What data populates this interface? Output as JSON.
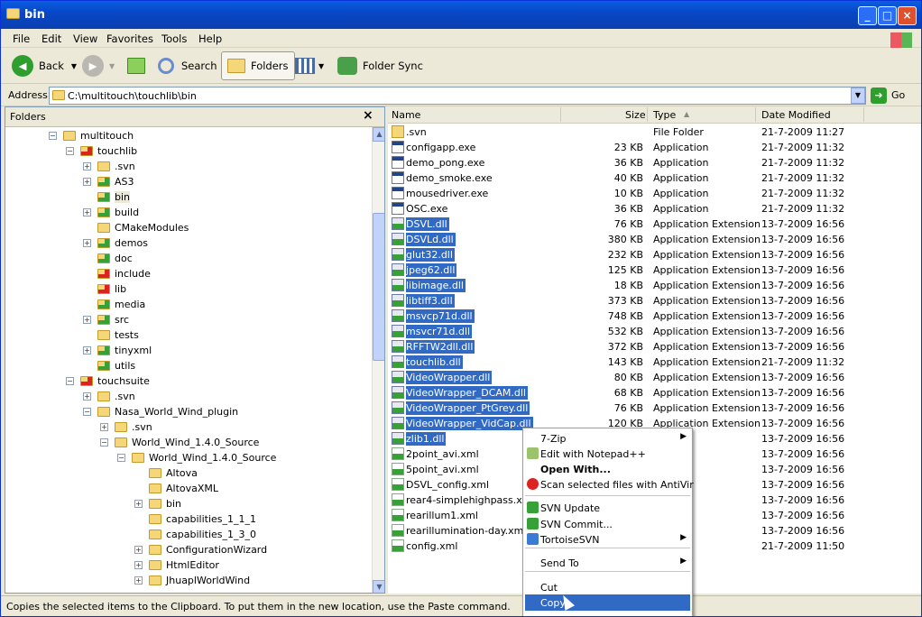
{
  "window": {
    "title": "bin"
  },
  "menu": [
    "File",
    "Edit",
    "View",
    "Favorites",
    "Tools",
    "Help"
  ],
  "toolbar": {
    "back": "Back",
    "search": "Search",
    "folders": "Folders",
    "folder_sync": "Folder Sync"
  },
  "address": {
    "label": "Address",
    "value": "C:\\multitouch\\touchlib\\bin",
    "go": "Go"
  },
  "folders_pane": {
    "title": "Folders",
    "close": "×",
    "items": [
      {
        "label": "multitouch",
        "expander": "−",
        "style": ""
      },
      {
        "label": "touchlib",
        "expander": "−",
        "style": "red"
      },
      {
        "label": ".svn",
        "expander": "+",
        "style": ""
      },
      {
        "label": "AS3",
        "expander": "+",
        "style": "svn"
      },
      {
        "label": "bin",
        "expander": "",
        "style": "svn"
      },
      {
        "label": "build",
        "expander": "+",
        "style": "svn"
      },
      {
        "label": "CMakeModules",
        "expander": "",
        "style": ""
      },
      {
        "label": "demos",
        "expander": "+",
        "style": "svn"
      },
      {
        "label": "doc",
        "expander": "",
        "style": "svn"
      },
      {
        "label": "include",
        "expander": "",
        "style": "red"
      },
      {
        "label": "lib",
        "expander": "",
        "style": "red"
      },
      {
        "label": "media",
        "expander": "",
        "style": "svn"
      },
      {
        "label": "src",
        "expander": "+",
        "style": "svn"
      },
      {
        "label": "tests",
        "expander": "",
        "style": ""
      },
      {
        "label": "tinyxml",
        "expander": "+",
        "style": "svn"
      },
      {
        "label": "utils",
        "expander": "",
        "style": "svn"
      },
      {
        "label": "touchsuite",
        "expander": "−",
        "style": "red"
      },
      {
        "label": ".svn",
        "expander": "+",
        "style": ""
      },
      {
        "label": "Nasa_World_Wind_plugin",
        "expander": "−",
        "style": ""
      },
      {
        "label": ".svn",
        "expander": "+",
        "style": ""
      },
      {
        "label": "World_Wind_1.4.0_Source",
        "expander": "−",
        "style": ""
      },
      {
        "label": "World_Wind_1.4.0_Source",
        "expander": "−",
        "style": ""
      },
      {
        "label": "Altova",
        "expander": "",
        "style": ""
      },
      {
        "label": "AltovaXML",
        "expander": "",
        "style": ""
      },
      {
        "label": "bin",
        "expander": "+",
        "style": ""
      },
      {
        "label": "capabilities_1_1_1",
        "expander": "",
        "style": ""
      },
      {
        "label": "capabilities_1_3_0",
        "expander": "",
        "style": ""
      },
      {
        "label": "ConfigurationWizard",
        "expander": "+",
        "style": ""
      },
      {
        "label": "HtmlEditor",
        "expander": "+",
        "style": ""
      },
      {
        "label": "JhuaplWorldWind",
        "expander": "+",
        "style": ""
      }
    ]
  },
  "columns": {
    "name": "Name",
    "size": "Size",
    "type": "Type",
    "date": "Date Modified"
  },
  "files": [
    {
      "name": ".svn",
      "size": "",
      "type": "File Folder",
      "date": "21-7-2009 11:27",
      "icon": "fld",
      "selected": false
    },
    {
      "name": "configapp.exe",
      "size": "23 KB",
      "type": "Application",
      "date": "21-7-2009 11:32",
      "icon": "exe",
      "selected": false
    },
    {
      "name": "demo_pong.exe",
      "size": "36 KB",
      "type": "Application",
      "date": "21-7-2009 11:32",
      "icon": "exe",
      "selected": false
    },
    {
      "name": "demo_smoke.exe",
      "size": "40 KB",
      "type": "Application",
      "date": "21-7-2009 11:32",
      "icon": "exe",
      "selected": false
    },
    {
      "name": "mousedriver.exe",
      "size": "10 KB",
      "type": "Application",
      "date": "21-7-2009 11:32",
      "icon": "exe",
      "selected": false
    },
    {
      "name": "OSC.exe",
      "size": "36 KB",
      "type": "Application",
      "date": "21-7-2009 11:32",
      "icon": "exe",
      "selected": false
    },
    {
      "name": "DSVL.dll",
      "size": "76 KB",
      "type": "Application Extension",
      "date": "13-7-2009 16:56",
      "icon": "dll",
      "selected": true
    },
    {
      "name": "DSVLd.dll",
      "size": "380 KB",
      "type": "Application Extension",
      "date": "13-7-2009 16:56",
      "icon": "dll",
      "selected": true
    },
    {
      "name": "glut32.dll",
      "size": "232 KB",
      "type": "Application Extension",
      "date": "13-7-2009 16:56",
      "icon": "dll",
      "selected": true
    },
    {
      "name": "jpeg62.dll",
      "size": "125 KB",
      "type": "Application Extension",
      "date": "13-7-2009 16:56",
      "icon": "dll",
      "selected": true
    },
    {
      "name": "libimage.dll",
      "size": "18 KB",
      "type": "Application Extension",
      "date": "13-7-2009 16:56",
      "icon": "dll",
      "selected": true
    },
    {
      "name": "libtiff3.dll",
      "size": "373 KB",
      "type": "Application Extension",
      "date": "13-7-2009 16:56",
      "icon": "dll",
      "selected": true
    },
    {
      "name": "msvcp71d.dll",
      "size": "748 KB",
      "type": "Application Extension",
      "date": "13-7-2009 16:56",
      "icon": "dll",
      "selected": true
    },
    {
      "name": "msvcr71d.dll",
      "size": "532 KB",
      "type": "Application Extension",
      "date": "13-7-2009 16:56",
      "icon": "dll",
      "selected": true
    },
    {
      "name": "RFFTW2dll.dll",
      "size": "372 KB",
      "type": "Application Extension",
      "date": "13-7-2009 16:56",
      "icon": "dll",
      "selected": true
    },
    {
      "name": "touchlib.dll",
      "size": "143 KB",
      "type": "Application Extension",
      "date": "21-7-2009 11:32",
      "icon": "dll",
      "selected": true
    },
    {
      "name": "VideoWrapper.dll",
      "size": "80 KB",
      "type": "Application Extension",
      "date": "13-7-2009 16:56",
      "icon": "dll",
      "selected": true
    },
    {
      "name": "VideoWrapper_DCAM.dll",
      "size": "68 KB",
      "type": "Application Extension",
      "date": "13-7-2009 16:56",
      "icon": "dll",
      "selected": true
    },
    {
      "name": "VideoWrapper_PtGrey.dll",
      "size": "76 KB",
      "type": "Application Extension",
      "date": "13-7-2009 16:56",
      "icon": "dll",
      "selected": true
    },
    {
      "name": "VideoWrapper_VidCap.dll",
      "size": "120 KB",
      "type": "Application Extension",
      "date": "13-7-2009 16:56",
      "icon": "dll",
      "selected": true
    },
    {
      "name": "zlib1.dll",
      "size": "",
      "type": "",
      "date": "13-7-2009 16:56",
      "icon": "dll",
      "selected": true
    },
    {
      "name": "2point_avi.xml",
      "size": "",
      "type": "ument",
      "date": "13-7-2009 16:56",
      "icon": "xml",
      "selected": false
    },
    {
      "name": "5point_avi.xml",
      "size": "",
      "type": "ument",
      "date": "13-7-2009 16:56",
      "icon": "xml",
      "selected": false
    },
    {
      "name": "DSVL_config.xml",
      "size": "",
      "type": "ument",
      "date": "13-7-2009 16:56",
      "icon": "xml",
      "selected": false
    },
    {
      "name": "rear4-simplehighpass.xml",
      "size": "",
      "type": "ument",
      "date": "13-7-2009 16:56",
      "icon": "xml",
      "selected": false
    },
    {
      "name": "rearillum1.xml",
      "size": "",
      "type": "ument",
      "date": "13-7-2009 16:56",
      "icon": "xml",
      "selected": false
    },
    {
      "name": "rearillumination-day.xml",
      "size": "",
      "type": "ument",
      "date": "13-7-2009 16:56",
      "icon": "xml",
      "selected": false
    },
    {
      "name": "config.xml",
      "size": "",
      "type": "ument",
      "date": "21-7-2009 11:50",
      "icon": "xml",
      "selected": false
    }
  ],
  "context_menu": [
    {
      "label": "7-Zip",
      "submenu": true,
      "bold": false,
      "icon": ""
    },
    {
      "label": "Edit with Notepad++",
      "submenu": false,
      "bold": false,
      "icon": "notepad-icon"
    },
    {
      "label": "Open With...",
      "submenu": false,
      "bold": true,
      "icon": ""
    },
    {
      "label": "Scan selected files with AntiVir",
      "submenu": false,
      "bold": false,
      "icon": "antivir-icon"
    },
    {
      "label": "SVN Update",
      "submenu": false,
      "bold": false,
      "icon": "svn-update-icon"
    },
    {
      "label": "SVN Commit...",
      "submenu": false,
      "bold": false,
      "icon": "svn-commit-icon"
    },
    {
      "label": "TortoiseSVN",
      "submenu": true,
      "bold": false,
      "icon": "tortoise-icon"
    },
    {
      "label": "Send To",
      "submenu": true,
      "bold": false,
      "icon": ""
    },
    {
      "label": "Cut",
      "submenu": false,
      "bold": false,
      "icon": ""
    },
    {
      "label": "Copy",
      "submenu": false,
      "bold": false,
      "icon": "",
      "highlighted": true
    }
  ],
  "status": "Copies the selected items to the Clipboard. To put them in the new location, use the Paste command.",
  "colors": {
    "selection": "#316ac5",
    "titlebar": "#0847c8"
  }
}
